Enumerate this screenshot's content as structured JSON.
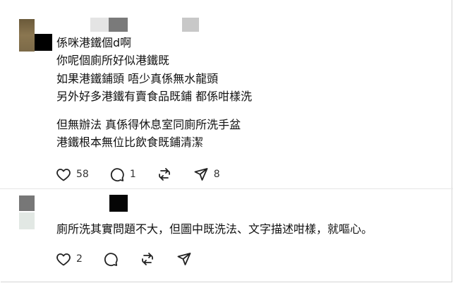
{
  "comment1": {
    "lines": [
      "係咪港鐵個d啊",
      "你呢個廁所好似港鐵既",
      "如果港鐵鋪頭 唔少真係無水龍頭",
      "另外好多港鐵有賣食品既鋪 都係咁樣洗"
    ],
    "lines2": [
      "但無辦法 真係得休息室同廁所洗手盆",
      "港鐵根本無位比飲食既鋪清潔"
    ],
    "likes": "58",
    "replies": "1",
    "shares": "8"
  },
  "comment2": {
    "text": "廁所洗其實問題不大，但圖中既洗法、文字描述咁樣，就嘔心。",
    "likes": "2"
  },
  "colors": {
    "icon": "#222222",
    "divider": "#e6e6e6"
  },
  "icons": [
    "heart-icon",
    "comment-icon",
    "repost-icon",
    "share-icon"
  ]
}
